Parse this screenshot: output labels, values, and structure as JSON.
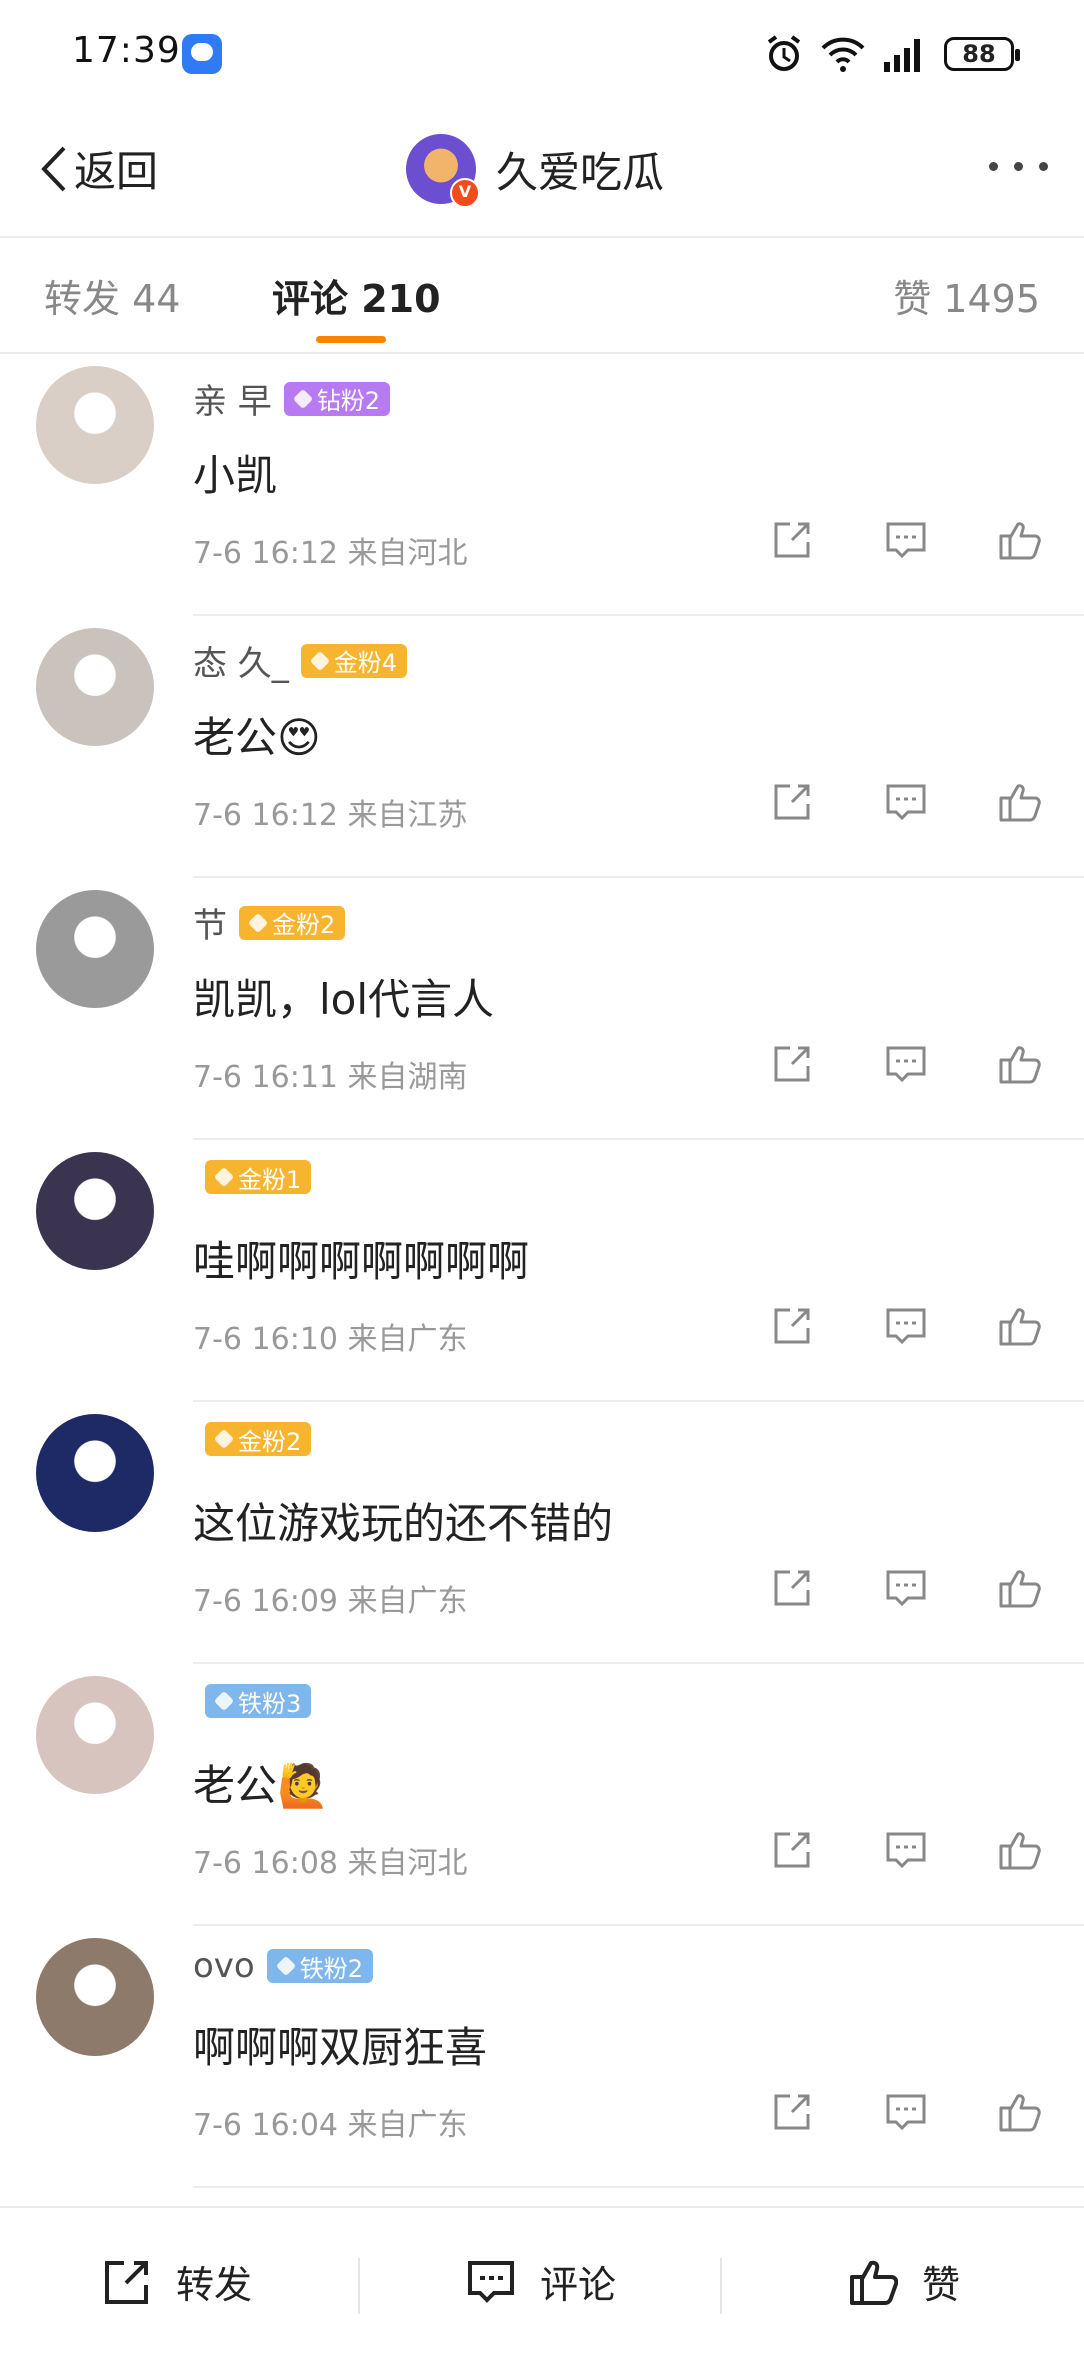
{
  "status_bar": {
    "time": "17:39",
    "battery": "88"
  },
  "header": {
    "back_label": "返回",
    "title": "久爱吃瓜",
    "verified_mark": "V"
  },
  "tabs": [
    {
      "label": "转发 44"
    },
    {
      "label": "评论 210"
    },
    {
      "label": "赞 1495"
    }
  ],
  "comments": [
    {
      "username": "亲            早",
      "badge": "钻粉2",
      "badge_color": "#b87af0",
      "text": "小凯",
      "meta": "7-6 16:12 来自河北",
      "avatar_color": "#d9cfc7"
    },
    {
      "username": "态    久_",
      "badge": "金粉4",
      "badge_color": "#f7b52f",
      "text": "老公😍",
      "meta": "7-6 16:12 来自江苏",
      "avatar_color": "#c9c2bd"
    },
    {
      "username": "        节",
      "badge": "金粉2",
      "badge_color": "#f7b52f",
      "text": "凯凯，lol代言人",
      "meta": "7-6 16:11 来自湖南",
      "avatar_color": "#9a9a9a"
    },
    {
      "username": "",
      "badge": "金粉1",
      "badge_color": "#f7b52f",
      "text": "哇啊啊啊啊啊啊啊",
      "meta": "7-6 16:10 来自广东",
      "avatar_color": "#3a3450"
    },
    {
      "username": "",
      "badge": "金粉2",
      "badge_color": "#f7b52f",
      "text": "这位游戏玩的还不错的",
      "meta": "7-6 16:09 来自广东",
      "avatar_color": "#1d2a66"
    },
    {
      "username": "",
      "badge": "铁粉3",
      "badge_color": "#7fb6ec",
      "text": "老公🙋",
      "meta": "7-6 16:08 来自河北",
      "avatar_color": "#d8c4bf"
    },
    {
      "username": "ovo",
      "badge": "铁粉2",
      "badge_color": "#7fb6ec",
      "text": "啊啊啊双厨狂喜",
      "meta": "7-6 16:04 来自广东",
      "avatar_color": "#8e7a6a"
    }
  ],
  "bottom_bar": {
    "repost": "转发",
    "comment": "评论",
    "like": "赞"
  }
}
